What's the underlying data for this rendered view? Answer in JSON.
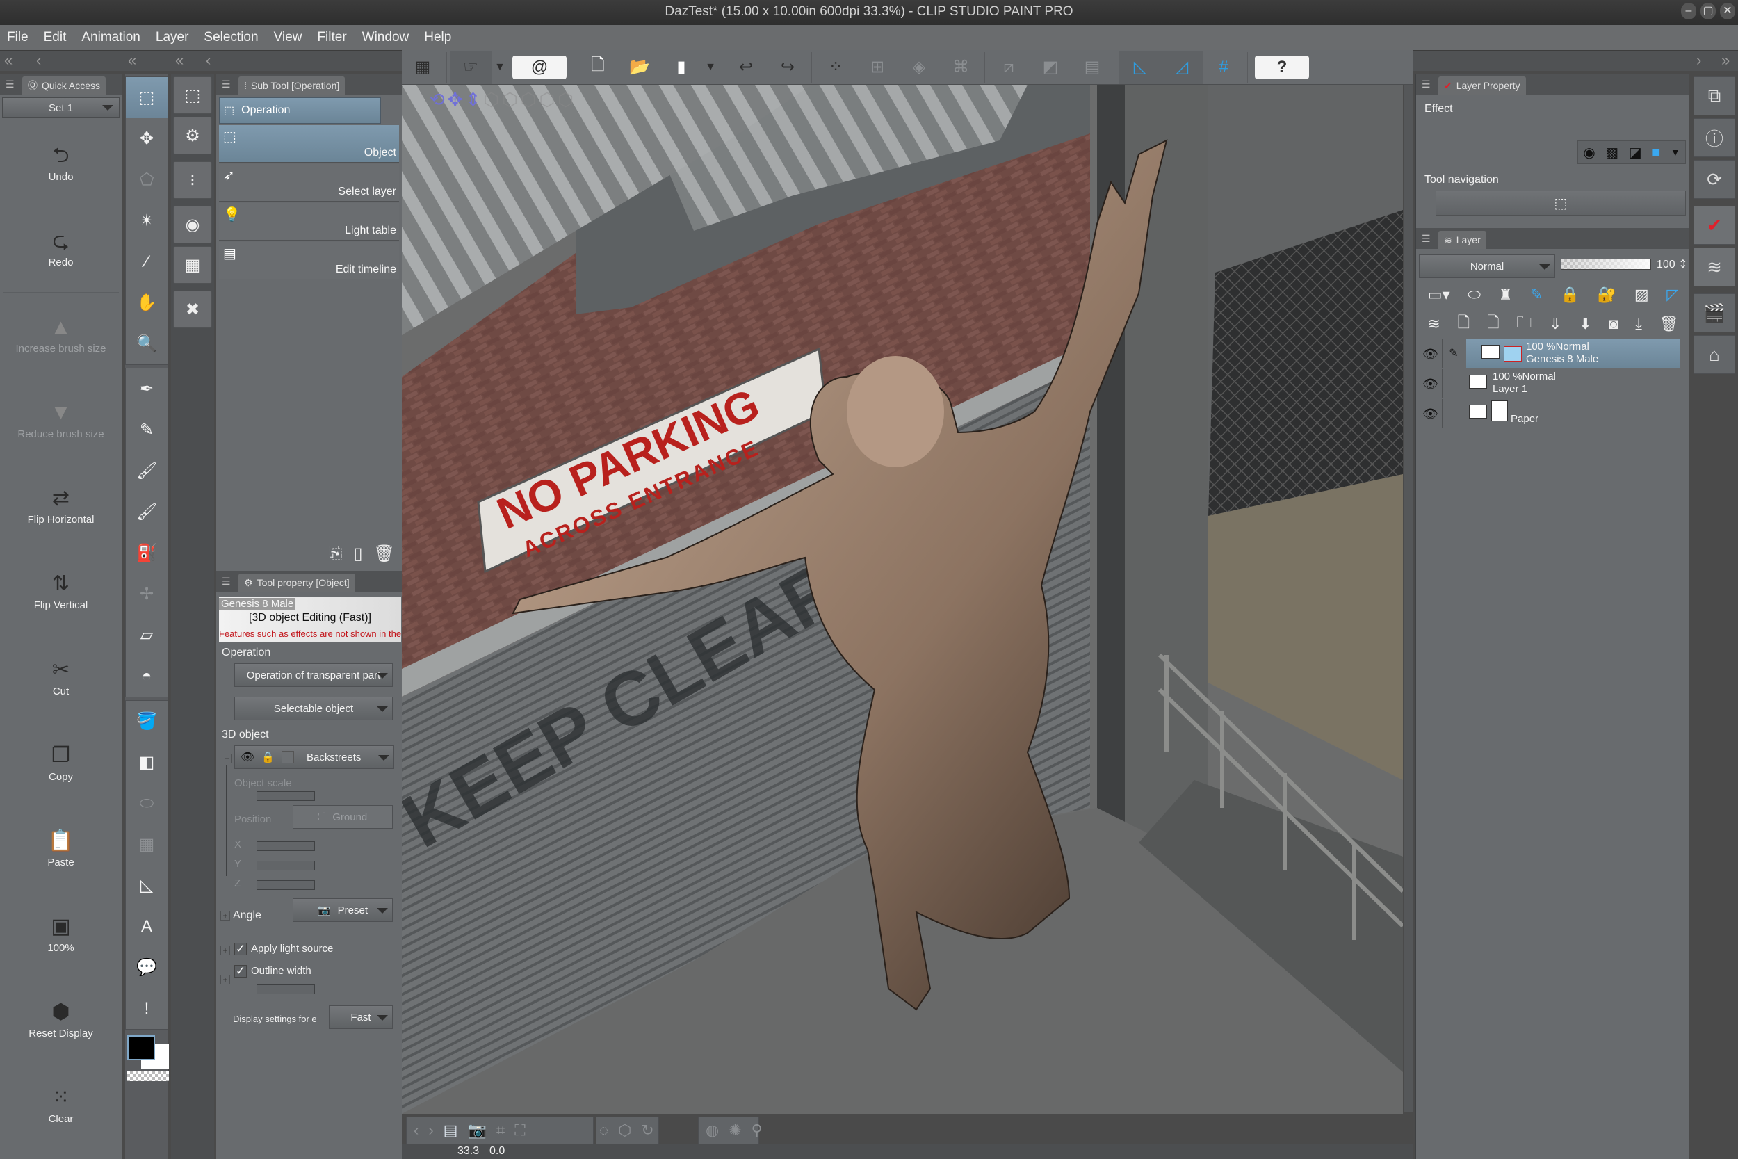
{
  "window": {
    "title": "DazTest* (15.00 x 10.00in 600dpi 33.3%)  - CLIP STUDIO PAINT PRO",
    "controls": [
      "minimize",
      "maximize",
      "close"
    ]
  },
  "menu": [
    "File",
    "Edit",
    "Animation",
    "Layer",
    "Selection",
    "View",
    "Filter",
    "Window",
    "Help"
  ],
  "quick_access": {
    "tab_label": "Quick Access",
    "set": "Set 1",
    "items": [
      {
        "label": "Undo",
        "icon": "undo-icon",
        "glyph": "⮌",
        "enabled": true
      },
      {
        "label": "Redo",
        "icon": "redo-icon",
        "glyph": "⮎",
        "enabled": true
      },
      {
        "label": "Increase brush size",
        "icon": "increase-icon",
        "glyph": "▲",
        "enabled": false
      },
      {
        "label": "Reduce brush size",
        "icon": "reduce-icon",
        "glyph": "▼",
        "enabled": false
      },
      {
        "label": "Flip Horizontal",
        "icon": "flip-horizontal-icon",
        "glyph": "⇄",
        "enabled": true
      },
      {
        "label": "Flip Vertical",
        "icon": "flip-vertical-icon",
        "glyph": "⇅",
        "enabled": true
      },
      {
        "label": "Cut",
        "icon": "scissors-icon",
        "glyph": "✂",
        "enabled": true
      },
      {
        "label": "Copy",
        "icon": "copy-icon",
        "glyph": "❐",
        "enabled": true
      },
      {
        "label": "Paste",
        "icon": "paste-icon",
        "glyph": "📋",
        "enabled": true
      },
      {
        "label": "100%",
        "icon": "actual-size-icon",
        "glyph": "▣",
        "enabled": true
      },
      {
        "label": "Reset Display",
        "icon": "reset-display-icon",
        "glyph": "⬢",
        "enabled": true
      },
      {
        "label": "Clear",
        "icon": "clear-icon",
        "glyph": "⁙",
        "enabled": true
      }
    ]
  },
  "tools": [
    {
      "name": "operation-tool",
      "glyph": "⬚",
      "selected": true
    },
    {
      "name": "move-tool",
      "glyph": "✥"
    },
    {
      "name": "lasso-tool",
      "glyph": "⬠",
      "dim": true
    },
    {
      "name": "magic-wand-tool",
      "glyph": "✴"
    },
    {
      "name": "eyedropper-tool",
      "glyph": "⁄"
    },
    {
      "name": "hand-tool",
      "glyph": "✋"
    },
    {
      "name": "zoom-tool",
      "glyph": "🔍"
    },
    {
      "name": "pen-tool",
      "glyph": "✒"
    },
    {
      "name": "pencil-tool",
      "glyph": "✎"
    },
    {
      "name": "brush-tool",
      "glyph": "🖌"
    },
    {
      "name": "brush-tool-2",
      "glyph": "🖌"
    },
    {
      "name": "airbrush-tool",
      "glyph": "⛽"
    },
    {
      "name": "decoration-tool",
      "glyph": "✢",
      "dim": true
    },
    {
      "name": "eraser-tool",
      "glyph": "▱"
    },
    {
      "name": "blend-tool",
      "glyph": "◓"
    },
    {
      "name": "fill-tool",
      "glyph": "🪣"
    },
    {
      "name": "gradient-tool",
      "glyph": "◧"
    },
    {
      "name": "figure-tool",
      "glyph": "⬭",
      "dim": true
    },
    {
      "name": "frame-tool",
      "glyph": "▦",
      "dim": true
    },
    {
      "name": "ruler-tool",
      "glyph": "◺"
    },
    {
      "name": "text-tool",
      "glyph": "A"
    },
    {
      "name": "balloon-tool",
      "glyph": "💬"
    },
    {
      "name": "correct-line-tool",
      "glyph": "!"
    }
  ],
  "sub_tool_groups": [
    "sub-tool-list-icon",
    "tool-property-icon",
    "brush-size-icon",
    "color-wheel-icon",
    "material-icon"
  ],
  "sub_tool": {
    "tab_label": "Sub Tool [Operation]",
    "group_label": "Operation",
    "items": [
      {
        "label": "Object",
        "glyph": "⬚",
        "selected": true
      },
      {
        "label": "Select layer",
        "glyph": "➶"
      },
      {
        "label": "Light table",
        "glyph": "💡"
      },
      {
        "label": "Edit timeline",
        "glyph": "▤"
      }
    ]
  },
  "tool_property": {
    "tab_label": "Tool property [Object]",
    "object_name": "Genesis 8 Male",
    "mode": "[3D object Editing (Fast)]",
    "warning": "Features such as effects are not shown in the Fast display mode",
    "operation_label": "Operation",
    "transparent_op": "Operation of transparent part",
    "selectable": "Selectable object",
    "object3d_label": "3D object",
    "object3d_value": "Backstreets",
    "object_scale": "Object scale",
    "position": "Position",
    "ground": "Ground",
    "axes": [
      "X",
      "Y",
      "Z"
    ],
    "angle": "Angle",
    "preset": "Preset",
    "apply_light": "Apply light source",
    "apply_light_checked": true,
    "outline": "Outline width",
    "outline_checked": true,
    "display_settings": "Display settings for editi",
    "display_value": "Fast"
  },
  "toolbar": {
    "buttons": [
      "show-windows",
      "clip-studio",
      "launch-clip-studio",
      "new",
      "open",
      "save",
      "undo",
      "redo",
      "deselect",
      "transform",
      "fill",
      "close-gap",
      "clear-outside",
      "invert-selection",
      "frame-border",
      "snap-ruler",
      "snap-special-ruler",
      "snap-grid",
      "help"
    ]
  },
  "canvas": {
    "sign_line1": "NO PARKING",
    "sign_line2": "ACROSS ENTRANCE",
    "door_text": "KEEP CLEAR"
  },
  "status": {
    "zoom": "33.3",
    "rotation": "0.0"
  },
  "layer_property": {
    "tab_label": "Layer Property",
    "effect": "Effect",
    "tool_navigation": "Tool navigation",
    "effect_color": "#3aa8f0"
  },
  "layer_panel": {
    "tab_label": "Layer",
    "blend_mode": "Normal",
    "opacity": "100",
    "layers": [
      {
        "line1": "100 %Normal",
        "line2": "Genesis 8 Male",
        "selected": true
      },
      {
        "line1": "100 %Normal",
        "line2": "Layer 1",
        "selected": false
      },
      {
        "line1": "",
        "line2": "Paper",
        "selected": false
      }
    ]
  },
  "colors": {
    "accent": "#7f9aae",
    "panel": "#686b6e",
    "warning": "#c3151b",
    "snap": "#2e9de0"
  }
}
